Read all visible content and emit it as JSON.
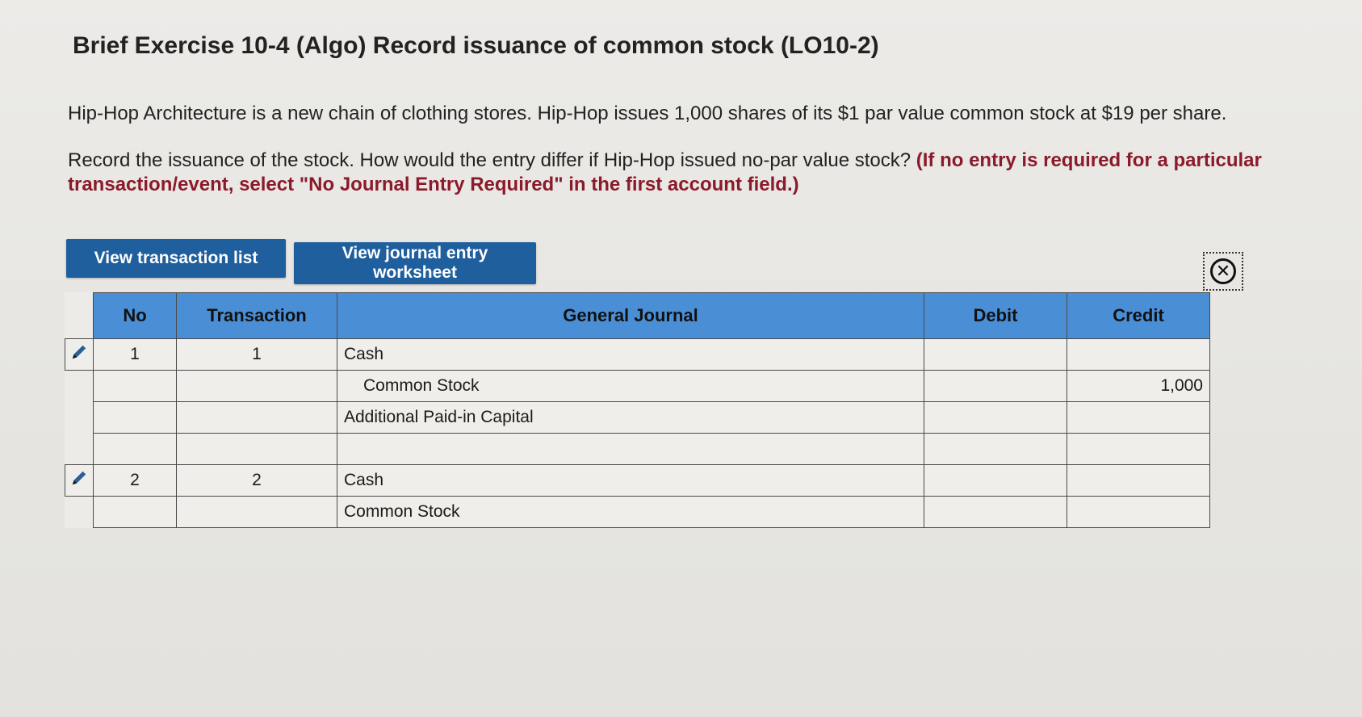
{
  "title": "Brief Exercise 10-4 (Algo) Record issuance of common stock (LO10-2)",
  "paragraph1": "Hip-Hop Architecture is a new chain of clothing stores. Hip-Hop issues 1,000 shares of its $1 par value common stock at $19 per share.",
  "paragraph2": "Record the issuance of the stock. How would the entry differ if Hip-Hop issued no-par value stock?",
  "instruction": "(If no entry is required for a particular transaction/event, select \"No Journal Entry Required\" in the first account field.)",
  "buttons": {
    "view_transaction_list": "View transaction list",
    "view_journal_entry_worksheet": "View journal entry worksheet"
  },
  "close_icon": "circled-x-icon",
  "table": {
    "headers": {
      "no": "No",
      "transaction": "Transaction",
      "general_journal": "General Journal",
      "debit": "Debit",
      "credit": "Credit"
    },
    "rows": [
      {
        "no": "1",
        "transaction": "1",
        "account": "Cash",
        "debit": "",
        "credit": ""
      },
      {
        "no": "",
        "transaction": "",
        "account": "Common Stock",
        "debit": "",
        "credit": "1,000"
      },
      {
        "no": "",
        "transaction": "",
        "account": "Additional Paid-in Capital",
        "debit": "",
        "credit": ""
      },
      {
        "no": "",
        "transaction": "",
        "account": "",
        "debit": "",
        "credit": ""
      },
      {
        "no": "2",
        "transaction": "2",
        "account": "Cash",
        "debit": "",
        "credit": ""
      },
      {
        "no": "",
        "transaction": "",
        "account": "Common Stock",
        "debit": "",
        "credit": ""
      }
    ]
  },
  "colors": {
    "button_bg": "#1f5f9e",
    "header_bg": "#4a8fd6",
    "instruction_text": "#8b1a2a"
  }
}
